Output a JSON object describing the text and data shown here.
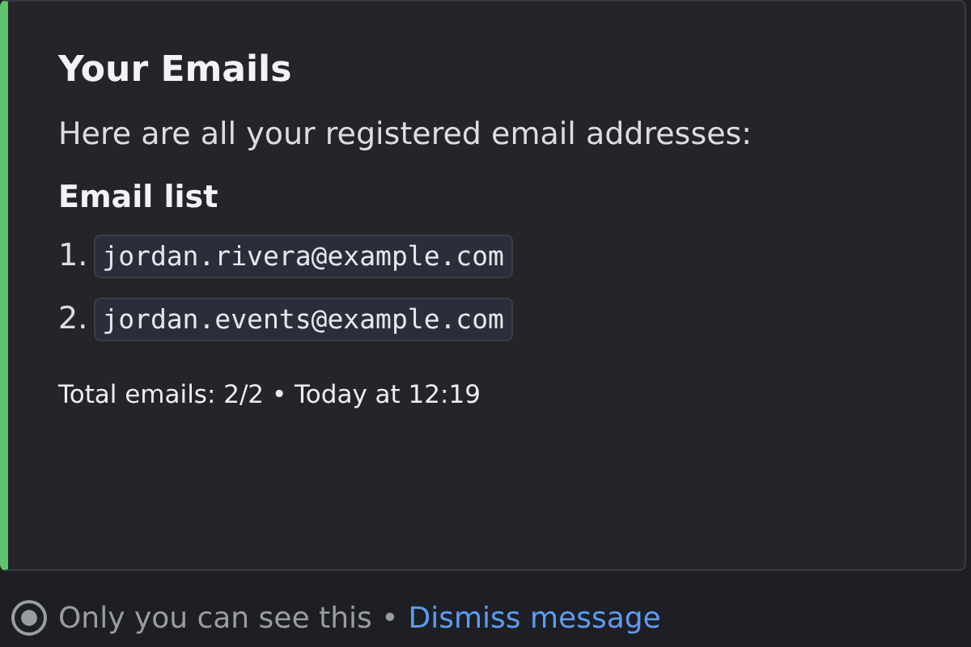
{
  "embed": {
    "title": "Your Emails",
    "description": "Here are all your registered email addresses:",
    "list_title": "Email list",
    "emails": [
      {
        "number": "1.",
        "address": "jordan.rivera@example.com"
      },
      {
        "number": "2.",
        "address": "jordan.events@example.com"
      }
    ],
    "footer": "Total emails: 2/2 • Today at 12:19"
  },
  "notice": {
    "text": "Only you can see this •",
    "link": "Dismiss message"
  }
}
